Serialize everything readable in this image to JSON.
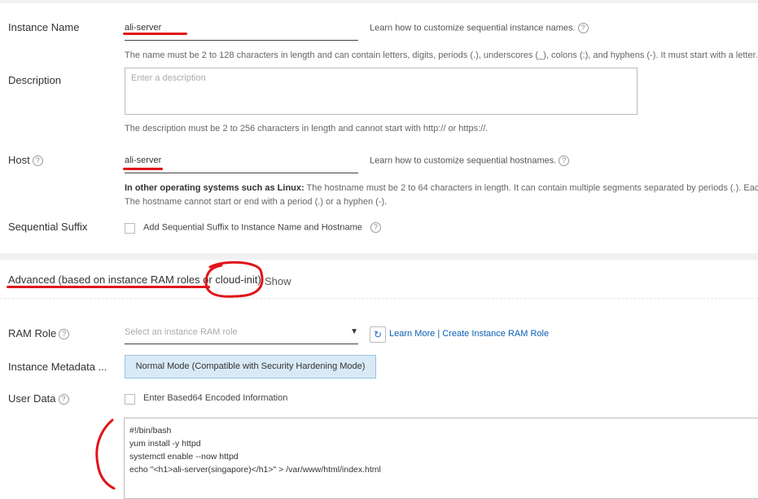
{
  "basic": {
    "instance_name": {
      "label": "Instance Name",
      "value": "ali-server",
      "hint_link": "Learn how to customize sequential instance names.",
      "help": "The name must be 2 to 128 characters in length and can contain letters, digits, periods (.), underscores (_), colons (:), and hyphens (-). It must start with a letter."
    },
    "description": {
      "label": "Description",
      "placeholder": "Enter a description",
      "help": "The description must be 2 to 256 characters in length and cannot start with http:// or https://."
    },
    "host": {
      "label": "Host",
      "value": "ali-server",
      "hint_link": "Learn how to customize sequential hostnames.",
      "help_bold": "In other operating systems such as Linux:",
      "help_line1": " The hostname must be 2 to 64 characters in length. It can contain multiple segments separated by periods (.). Each segm",
      "help_line2": "The hostname cannot start or end with a period (.) or a hyphen (-)."
    },
    "sequential_suffix": {
      "label": "Sequential Suffix",
      "checkbox_label": "Add Sequential Suffix to Instance Name and Hostname"
    }
  },
  "advanced": {
    "title": "Advanced (based on instance RAM roles or cloud-init)",
    "toggle": "Show",
    "ram_role": {
      "label": "RAM Role",
      "placeholder": "Select an instance RAM role",
      "learn_more": "Learn More",
      "separator": "|",
      "create_link": "Create Instance RAM Role"
    },
    "instance_metadata": {
      "label": "Instance Metadata ...",
      "mode": "Normal Mode (Compatible with Security Hardening Mode)"
    },
    "user_data": {
      "label": "User Data",
      "checkbox_label": "Enter Based64 Encoded Information",
      "lines": [
        "#!/bin/bash",
        "yum install -y httpd",
        "systemctl enable --now httpd",
        "echo \"<h1>ali-server(singapore)</h1>\" > /var/www/html/index.html"
      ]
    }
  },
  "colors": {
    "annotation_red": "#e0141a",
    "link_blue": "#0a5fb4",
    "mode_bg": "#d9eaf7"
  }
}
